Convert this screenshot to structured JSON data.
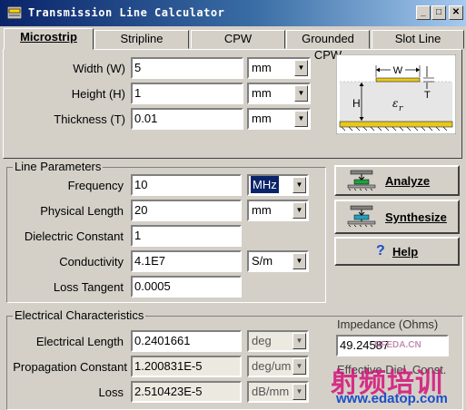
{
  "window": {
    "title": "Transmission Line Calculator"
  },
  "tabs": [
    "Microstrip",
    "Stripline",
    "CPW",
    "Grounded CPW",
    "Slot Line"
  ],
  "geometry": {
    "rows": [
      {
        "label": "Width (W)",
        "value": "5",
        "unit": "mm"
      },
      {
        "label": "Height (H)",
        "value": "1",
        "unit": "mm"
      },
      {
        "label": "Thickness (T)",
        "value": "0.01",
        "unit": "mm"
      }
    ],
    "diagram": {
      "w": "W",
      "h": "H",
      "t": "T",
      "er": "ε",
      "er_sub": "r"
    }
  },
  "line_params": {
    "title": "Line Parameters",
    "rows": [
      {
        "label": "Frequency",
        "value": "10",
        "unit": "MHz"
      },
      {
        "label": "Physical Length",
        "value": "20",
        "unit": "mm"
      },
      {
        "label": "Dielectric Constant",
        "value": "1",
        "unit": ""
      },
      {
        "label": "Conductivity",
        "value": "4.1E7",
        "unit": "S/m"
      },
      {
        "label": "Loss Tangent",
        "value": "0.0005",
        "unit": ""
      }
    ]
  },
  "buttons": {
    "analyze": "Analyze",
    "synthesize": "Synthesize",
    "help": "Help",
    "help_glyph": "?"
  },
  "electrical": {
    "title": "Electrical Characteristics",
    "rows": [
      {
        "label": "Electrical Length",
        "value": "0.2401661",
        "unit": "deg"
      },
      {
        "label": "Propagation Constant",
        "value": "1.200831E-5",
        "unit": "deg/um"
      },
      {
        "label": "Loss",
        "value": "2.510423E-5",
        "unit": "dB/mm"
      }
    ],
    "impedance_label": "Impedance (Ohms)",
    "impedance_value": "49.24587",
    "eff_label": "Effective Diel. Const."
  },
  "watermark": {
    "logo": "RFEDA.CN",
    "cn": "射频培训",
    "url": "www.edatop.com"
  },
  "colors": {
    "title_start": "#0a246a",
    "title_end": "#a6caf0",
    "face": "#d4d0c8",
    "selection": "#0a246a"
  }
}
